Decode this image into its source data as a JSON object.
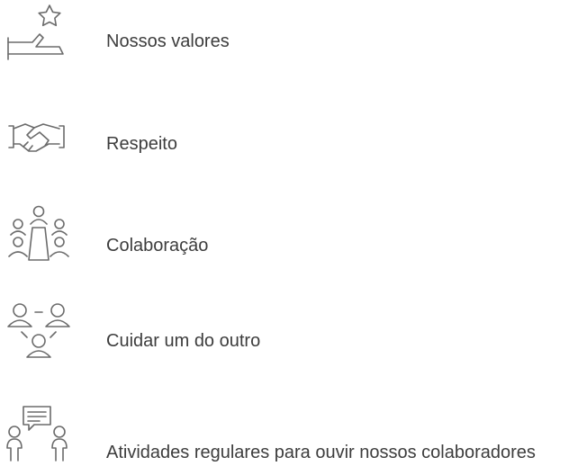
{
  "values": {
    "items": [
      {
        "label": "Nossos valores",
        "icon": "star-hand-icon"
      },
      {
        "label": "Respeito",
        "icon": "handshake-icon"
      },
      {
        "label": "Colaboração",
        "icon": "team-table-icon"
      },
      {
        "label": "Cuidar um do outro",
        "icon": "people-network-icon"
      },
      {
        "label": "Atividades regulares para ouvir nossos colaboradores",
        "icon": "people-feedback-icon"
      }
    ]
  },
  "colors": {
    "text": "#3d3d3d",
    "icon_stroke": "#6b6b6b",
    "background": "#ffffff"
  }
}
